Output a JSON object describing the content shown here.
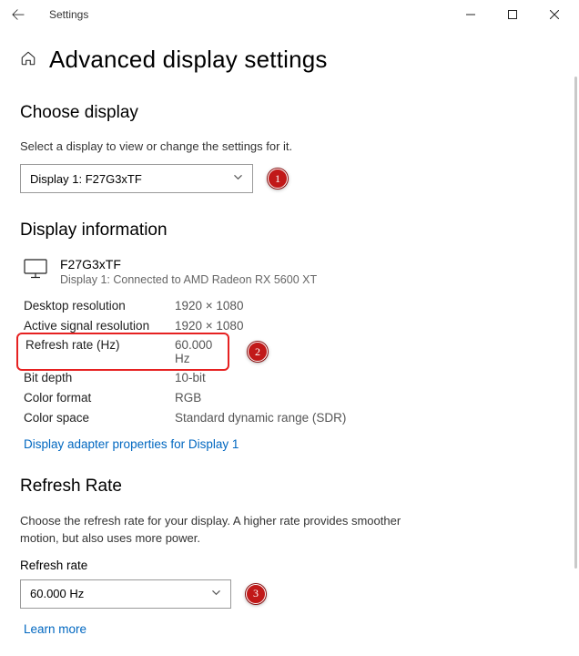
{
  "titlebar": {
    "appTitle": "Settings"
  },
  "header": {
    "pageTitle": "Advanced display settings"
  },
  "chooseDisplay": {
    "heading": "Choose display",
    "help": "Select a display to view or change the settings for it.",
    "selected": "Display 1: F27G3xTF"
  },
  "displayInfo": {
    "heading": "Display information",
    "monitorName": "F27G3xTF",
    "monitorSub": "Display 1: Connected to AMD Radeon RX 5600 XT",
    "rows": {
      "desktopRes": {
        "label": "Desktop resolution",
        "value": "1920 × 1080"
      },
      "activeRes": {
        "label": "Active signal resolution",
        "value": "1920 × 1080"
      },
      "refreshRate": {
        "label": "Refresh rate (Hz)",
        "value": "60.000 Hz"
      },
      "bitDepth": {
        "label": "Bit depth",
        "value": "10-bit"
      },
      "colorFormat": {
        "label": "Color format",
        "value": "RGB"
      },
      "colorSpace": {
        "label": "Color space",
        "value": "Standard dynamic range (SDR)"
      }
    },
    "adapterLink": "Display adapter properties for Display 1"
  },
  "refreshRate": {
    "heading": "Refresh Rate",
    "help": "Choose the refresh rate for your display. A higher rate provides smoother motion, but also uses more power.",
    "fieldLabel": "Refresh rate",
    "selected": "60.000 Hz",
    "learnMore": "Learn more"
  },
  "badges": {
    "one": "1",
    "two": "2",
    "three": "3"
  }
}
